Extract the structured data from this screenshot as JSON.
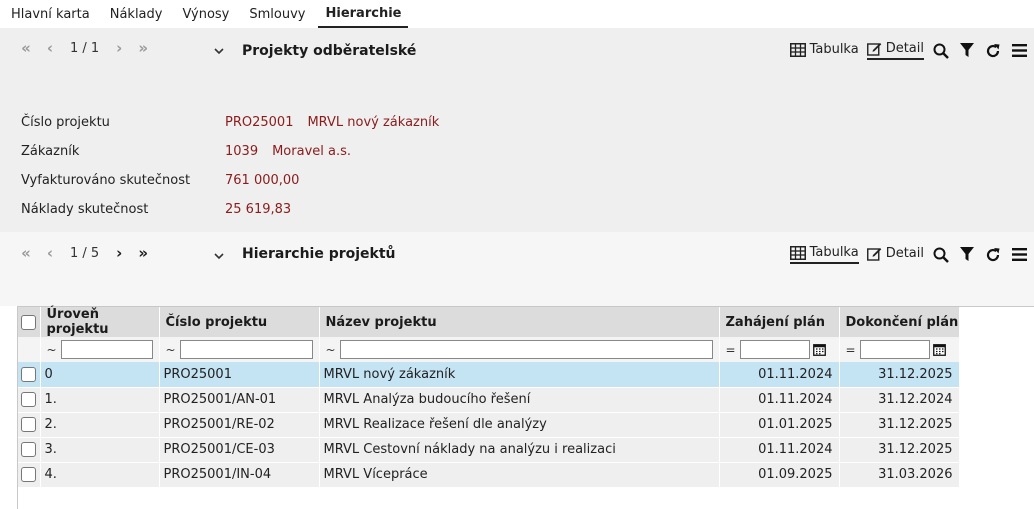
{
  "tabs": [
    "Hlavní karta",
    "Náklady",
    "Výnosy",
    "Smlouvy",
    "Hierarchie"
  ],
  "active_tab": "Hierarchie",
  "panel1": {
    "pager_count": "1 / 1",
    "title": "Projekty odběratelské",
    "toolbar": {
      "table_label": "Tabulka",
      "detail_label": "Detail",
      "active": "Detail"
    },
    "fields": [
      {
        "label": "Číslo projektu",
        "value": "PRO25001",
        "value2": "MRVL nový zákazník"
      },
      {
        "label": "Zákazník",
        "value": "1039",
        "value2": "Moravel a.s."
      },
      {
        "label": "Vyfakturováno skutečnost",
        "value": "761 000,00",
        "value2": ""
      },
      {
        "label": "Náklady skutečnost",
        "value": "25 619,83",
        "value2": ""
      }
    ]
  },
  "panel2": {
    "pager_count": "1 / 5",
    "title": "Hierarchie projektů",
    "toolbar": {
      "table_label": "Tabulka",
      "detail_label": "Detail",
      "active": "Tabulka"
    },
    "columns": [
      "Úroveň projektu",
      "Číslo projektu",
      "Název projektu",
      "Zahájení plán",
      "Dokončení plán"
    ],
    "filter_ops": [
      "~",
      "~",
      "~",
      "=",
      "="
    ],
    "rows": [
      {
        "level": "0",
        "number": "PRO25001",
        "name": "MRVL nový zákazník",
        "start": "01.11.2024",
        "end": "31.12.2025",
        "selected": true
      },
      {
        "level": "1.",
        "number": "PRO25001/AN-01",
        "name": "MRVL Analýza budoucího řešení",
        "start": "01.11.2024",
        "end": "31.12.2024",
        "selected": false
      },
      {
        "level": "2.",
        "number": "PRO25001/RE-02",
        "name": "MRVL Realizace řešení dle analýzy",
        "start": "01.01.2025",
        "end": "31.12.2025",
        "selected": false
      },
      {
        "level": "3.",
        "number": "PRO25001/CE-03",
        "name": "MRVL Cestovní náklady na analýzu i realizaci",
        "start": "01.11.2024",
        "end": "31.12.2025",
        "selected": false
      },
      {
        "level": "4.",
        "number": "PRO25001/IN-04",
        "name": "MRVL Vícepráce",
        "start": "01.09.2025",
        "end": "31.03.2026",
        "selected": false
      }
    ]
  },
  "icons": [
    "first-page-icon",
    "prev-page-icon",
    "next-page-icon",
    "last-page-icon",
    "chevron-down-icon",
    "table-icon",
    "edit-icon",
    "search-icon",
    "filter-icon",
    "refresh-icon",
    "menu-icon",
    "calendar-icon"
  ]
}
